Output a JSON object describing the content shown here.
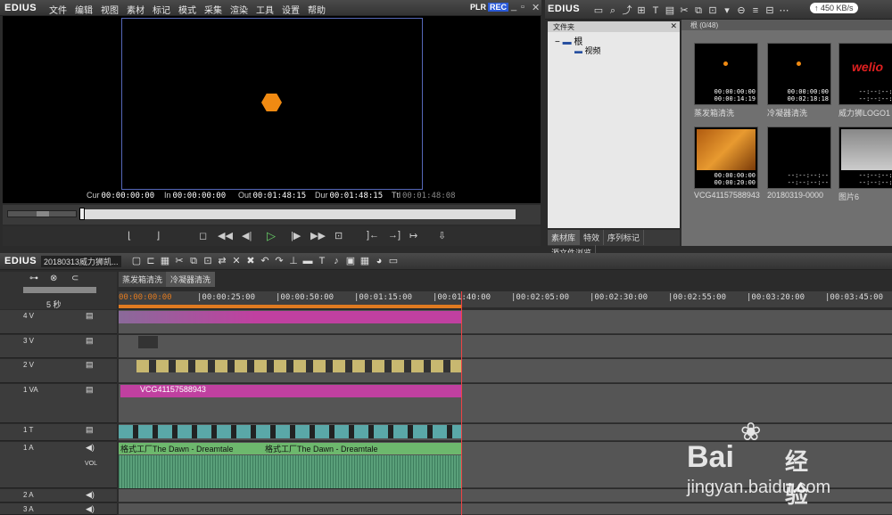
{
  "app": {
    "name": "EDIUS",
    "plr": "PLR",
    "rec": "REC",
    "menu": [
      "文件",
      "编辑",
      "视图",
      "素材",
      "标记",
      "模式",
      "采集",
      "渲染",
      "工具",
      "设置",
      "帮助"
    ]
  },
  "player": {
    "cur_label": "Cur",
    "cur": "00:00:00:00",
    "in_label": "In",
    "in": "00:00:00:00",
    "out_label": "Out",
    "out": "00:01:48:15",
    "dur_label": "Dur",
    "dur": "00:01:48:15",
    "ttl_label": "Ttl",
    "ttl": "00:01:48:08"
  },
  "bin": {
    "app_name": "EDIUS",
    "folder_header": "文件夹",
    "root": "根",
    "child": "视频",
    "clips_header": "根 (0/48)",
    "speed": "450 KB/s",
    "clips": [
      {
        "name": "蒸发箱清洗",
        "tc1": "00:00:00:00",
        "tc2": "00:00:14:19"
      },
      {
        "name": "冷凝器清洗",
        "tc1": "00:00:00:00",
        "tc2": "00:02:18:18"
      },
      {
        "name": "威力狮LOGO1",
        "tc1": "--:--:--:--",
        "tc2": "--:--:--:--",
        "logo": "welio"
      },
      {
        "name": "VCG41157588943",
        "tc1": "00:00:00:00",
        "tc2": "00:00:20:00"
      },
      {
        "name": "20180319-0000",
        "tc1": "--:--:--:--",
        "tc2": "--:--:--:--"
      },
      {
        "name": "图片6",
        "tc1": "--:--:--:--",
        "tc2": "--:--:--:--"
      }
    ],
    "tabs": [
      "素材库",
      "特效",
      "序列标记",
      "源文件浏览"
    ]
  },
  "timeline": {
    "app_name": "EDIUS",
    "project": "20180313威力狮凯...",
    "seq_tabs": [
      "蒸发箱清洗",
      "冷凝器清洗"
    ],
    "zoom": "5 秒",
    "ruler": [
      "00:00:00:00",
      "|00:00:25:00",
      "|00:00:50:00",
      "|00:01:15:00",
      "|00:01:40:00",
      "|00:02:05:00",
      "|00:02:30:00",
      "|00:02:55:00",
      "|00:03:20:00",
      "|00:03:45:00"
    ],
    "tracks": [
      "4 V",
      "3 V",
      "2 V",
      "1 VA",
      "1 T",
      "1 A",
      "2 A",
      "3 A"
    ],
    "clip_1va": "VCG41157588943",
    "audio_clip": "格式工厂The Dawn - Dreamtale",
    "audio_clip2": "格式工厂The Dawn - Dreamtale",
    "vol": "VOL"
  },
  "watermark": {
    "brand": "Bai",
    "brand2": "经验",
    "url": "jingyan.baidu.com"
  }
}
